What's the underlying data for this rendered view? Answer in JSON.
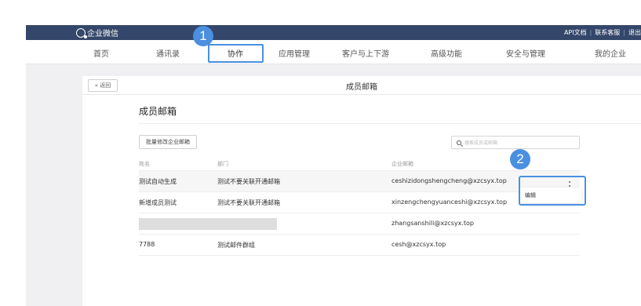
{
  "app": {
    "logo_text": "企业微信",
    "top_links": [
      "API文档",
      "联系客服",
      "退出"
    ]
  },
  "nav": {
    "items": [
      "首页",
      "通讯录",
      "协作",
      "应用管理",
      "客户与上下游",
      "高级功能",
      "安全与管理",
      "我的企业"
    ],
    "active": "协作"
  },
  "annotations": {
    "step1": "1",
    "step2": "2"
  },
  "page": {
    "back_label": "« 返回",
    "header_title": "成员邮箱",
    "section_title": "成员邮箱",
    "batch_button": "批量修改企业邮箱",
    "search_placeholder": "搜索成员或邮箱"
  },
  "table": {
    "columns": [
      "姓名",
      "部门",
      "企业邮箱"
    ],
    "rows": [
      {
        "name": "测试自动生成",
        "dept": "测试不要关联开通邮箱",
        "email": "ceshizidongshengcheng@xzcsyx.top"
      },
      {
        "name": "新增成员测试",
        "dept": "测试不要关联开通邮箱",
        "email": "xinzengchengyuanceshi@xzcsyx.top"
      },
      {
        "name": "",
        "dept": "",
        "email": "zhangsanshili@xzcsyx.top"
      },
      {
        "name": "7788",
        "dept": "测试邮件群组",
        "email": "cesh@xzcsyx.top"
      }
    ]
  },
  "row_menu": {
    "edit_label": "编辑"
  },
  "colors": {
    "topbar": "#34476a",
    "accent": "#4a90e2",
    "background": "#f0f0f2"
  }
}
